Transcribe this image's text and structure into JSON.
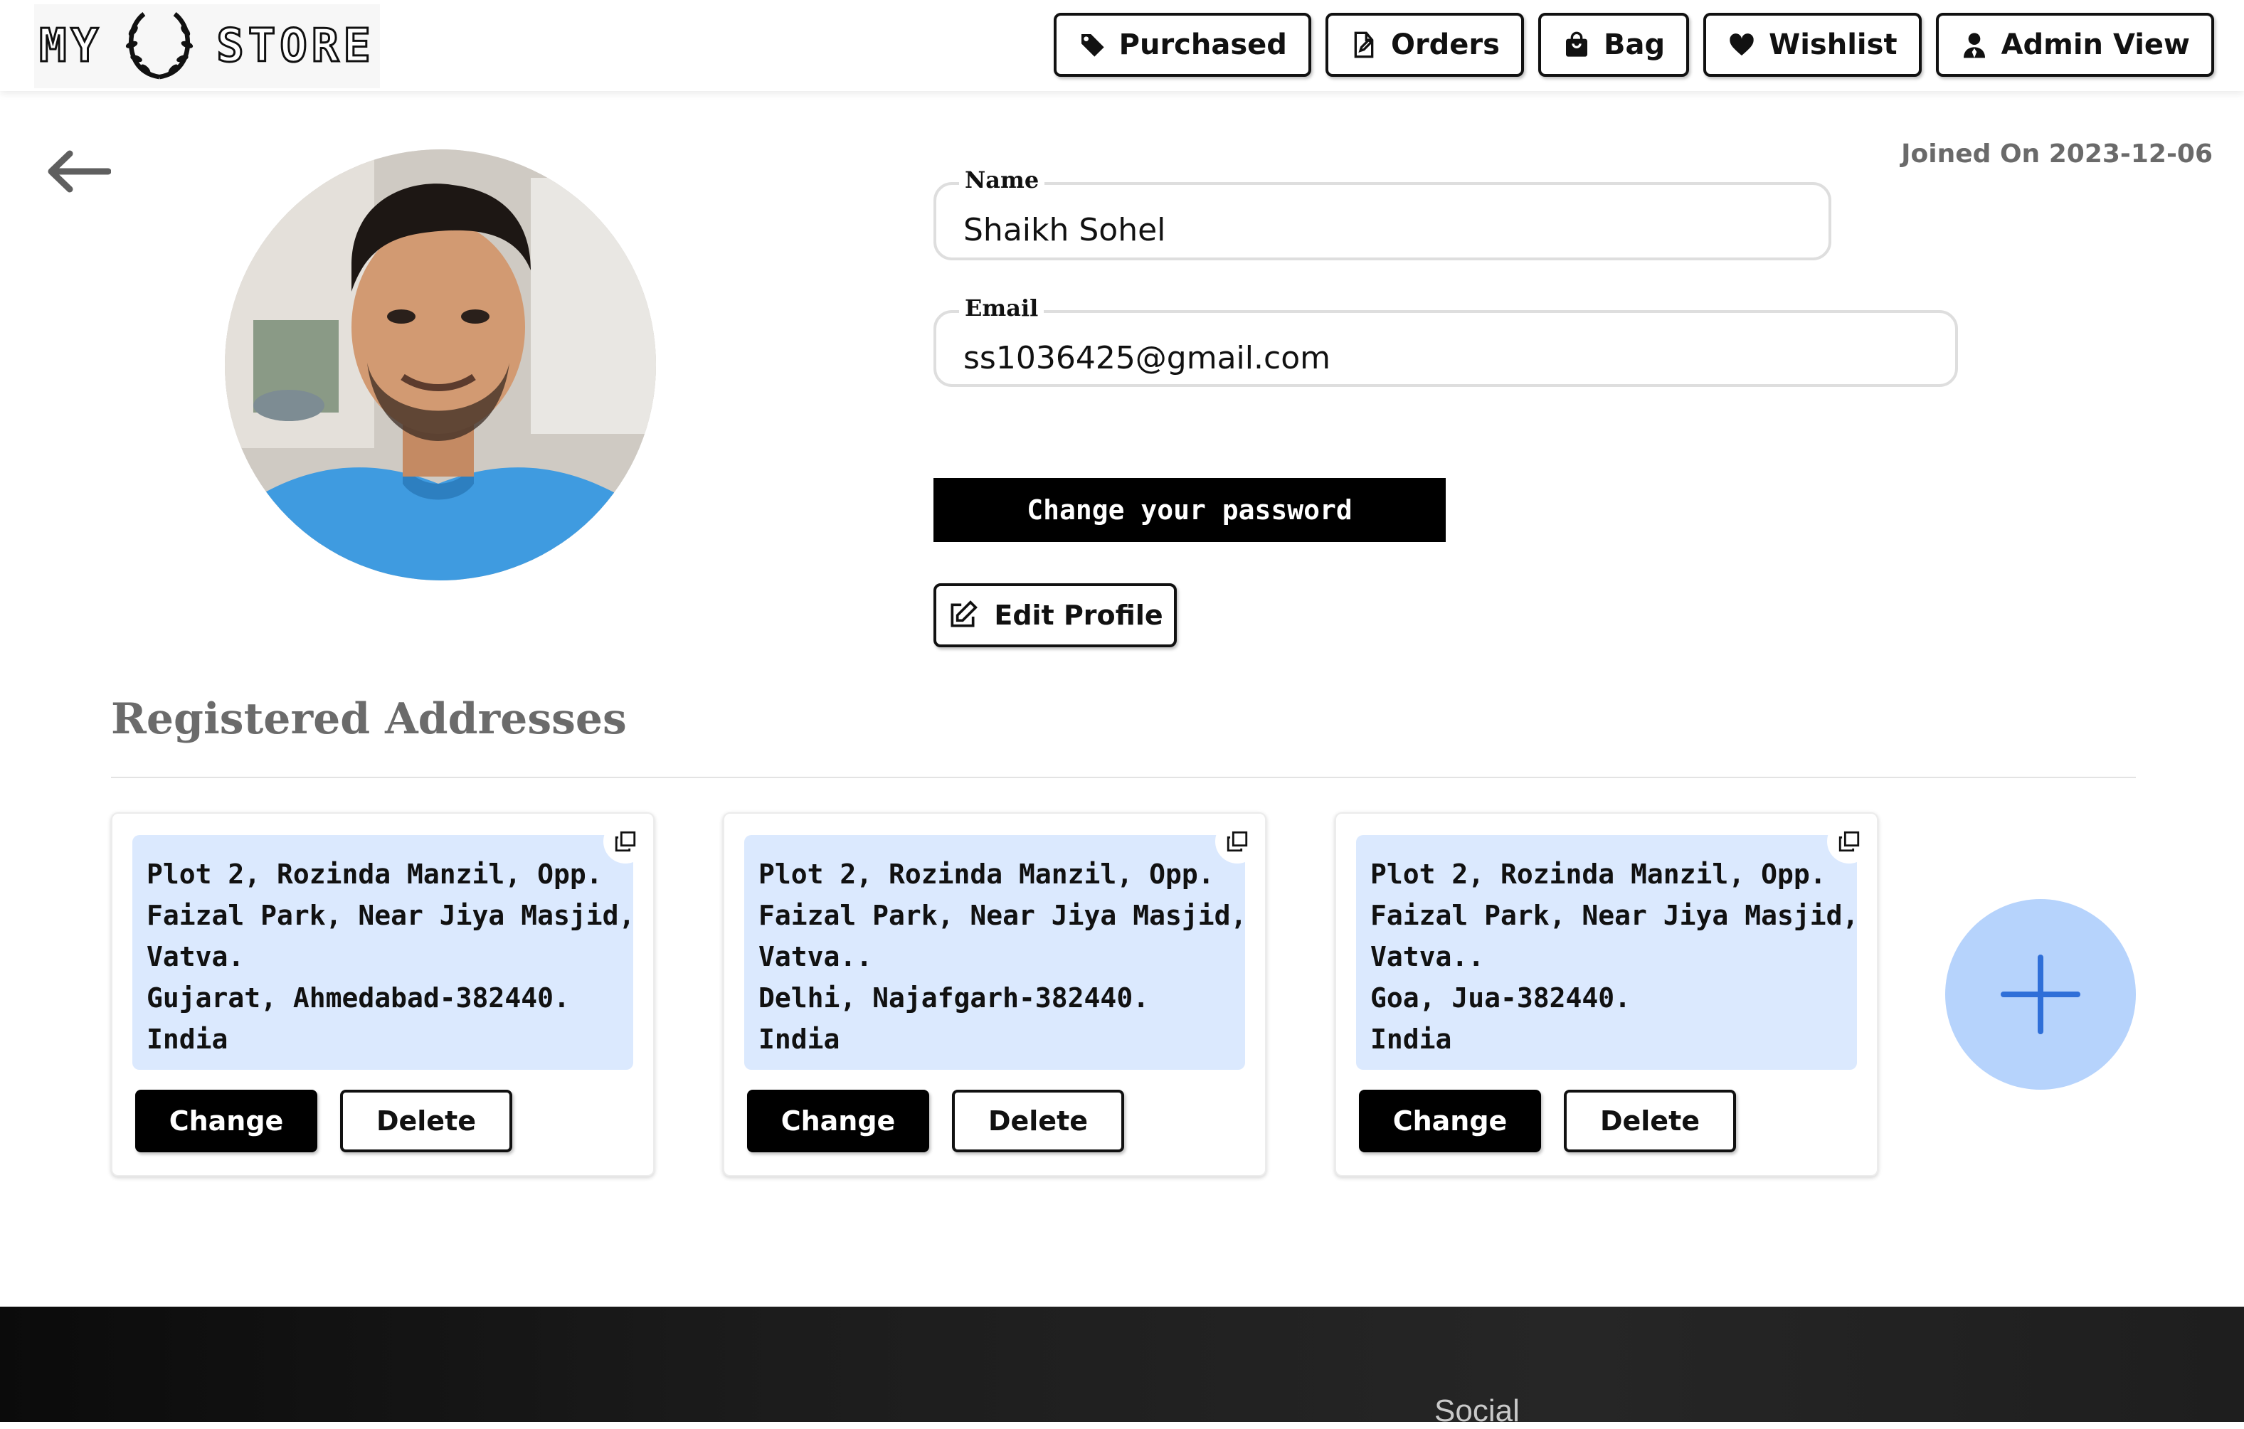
{
  "header": {
    "logo": {
      "left_word": "MY",
      "right_word": "STORE",
      "emblem_icon": "laurel-wreath-icon"
    },
    "nav": [
      {
        "label": "Purchased",
        "icon": "tag-icon"
      },
      {
        "label": "Orders",
        "icon": "edit-document-icon"
      },
      {
        "label": "Bag",
        "icon": "shopping-bag-icon"
      },
      {
        "label": "Wishlist",
        "icon": "heart-icon"
      },
      {
        "label": "Admin View",
        "icon": "user-admin-icon"
      }
    ]
  },
  "profile": {
    "joined": "Joined On 2023-12-06",
    "name_label": "Name",
    "name_value": "Shaikh Sohel",
    "email_label": "Email",
    "email_value": "ss1036425@gmail.com",
    "change_password_label": "Change your password",
    "edit_profile_label": "Edit Profile"
  },
  "addresses": {
    "title": "Registered Addresses",
    "change_label": "Change",
    "delete_label": "Delete",
    "items": [
      {
        "lines": [
          "Plot 2, Rozinda Manzil, Opp.",
          "Faizal Park, Near Jiya Masjid,",
          "Vatva.",
          "Gujarat, Ahmedabad-382440.",
          "India"
        ]
      },
      {
        "lines": [
          "Plot 2, Rozinda Manzil, Opp.",
          "Faizal Park, Near Jiya Masjid,",
          "Vatva..",
          "Delhi, Najafgarh-382440.",
          "India"
        ]
      },
      {
        "lines": [
          "Plot 2, Rozinda Manzil, Opp.",
          "Faizal Park, Near Jiya Masjid,",
          "Vatva..",
          "Goa, Jua-382440.",
          "India"
        ]
      }
    ]
  },
  "footer": {
    "social_label": "Social"
  },
  "colors": {
    "accent_blue": "#b6d3fc",
    "address_bg": "#dbe9fe",
    "plus_blue": "#2f6fd8"
  }
}
